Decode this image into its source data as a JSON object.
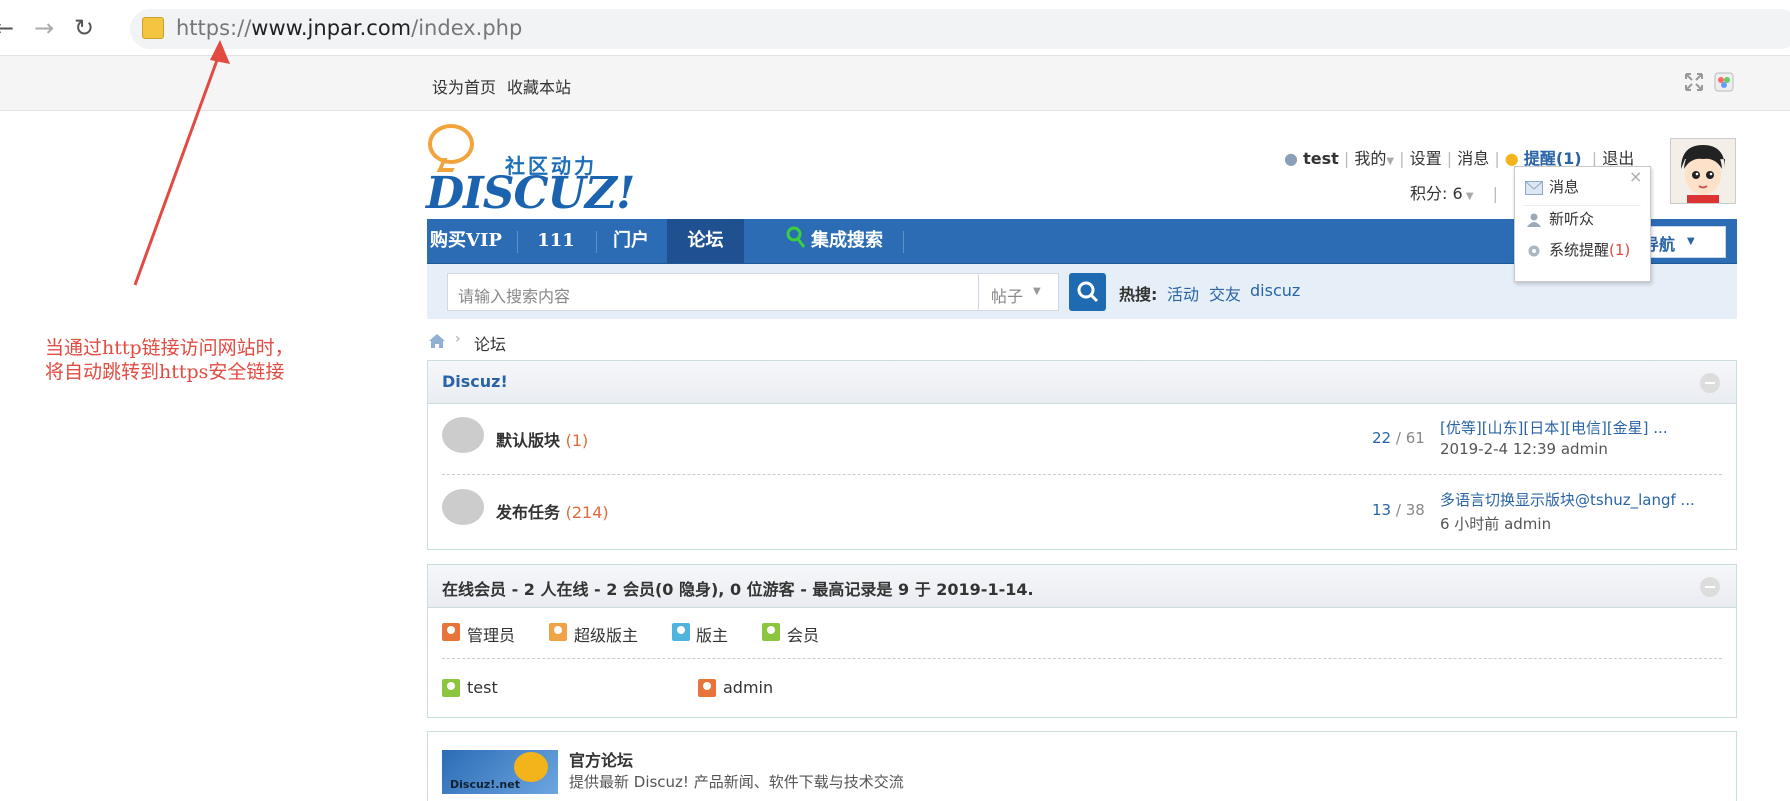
{
  "browser": {
    "url_prefix": "https://",
    "url_host": "www.jnpar.com",
    "url_path": "/index.php",
    "back": "←",
    "forward": "→",
    "reload": "↻"
  },
  "topbar": {
    "set_home": "设为首页",
    "bookmark": "收藏本站"
  },
  "logo": {
    "cn_text": "社区动力",
    "en_text": "DISCUZ!"
  },
  "user": {
    "name": "test",
    "my": "我的",
    "settings": "设置",
    "messages": "消息",
    "reminder": "提醒(1)",
    "logout": "退出",
    "credits": "积分: 6"
  },
  "reminder_popup": {
    "items": [
      {
        "label": "消息",
        "icon": "envelope-icon"
      },
      {
        "label": "新听众",
        "icon": "user-icon"
      },
      {
        "label": "系统提醒",
        "count": "(1)",
        "icon": "gear-icon"
      }
    ]
  },
  "nav": {
    "items": [
      "购买VIP",
      "111",
      "门户",
      "论坛",
      "集成搜索"
    ],
    "active_index": 3,
    "quick_nav": "导航"
  },
  "search": {
    "placeholder": "请输入搜索内容",
    "type": "帖子",
    "hot_label": "热搜:",
    "hot_links": [
      "活动",
      "交友",
      "discuz"
    ]
  },
  "breadcrumb": {
    "current": "论坛"
  },
  "forum_group": {
    "title": "Discuz!",
    "forums": [
      {
        "name": "默认版块",
        "count": "(1)",
        "threads": "22",
        "posts": "61",
        "last_title": "[优等][山东][日本][电信][金星] ...",
        "last_meta": "2019-2-4 12:39 admin"
      },
      {
        "name": "发布任务",
        "count": "(214)",
        "threads": "13",
        "posts": "38",
        "last_title": "多语言切换显示版块@tshuz_langf ...",
        "last_meta": "6 小时前 admin"
      }
    ]
  },
  "online": {
    "title": "在线会员 - 2 人在线 - 2 会员(0 隐身), 0 位游客 - 最高记录是 9 于 2019-1-14.",
    "legend": [
      {
        "label": "管理员",
        "color": "#e8743b"
      },
      {
        "label": "超级版主",
        "color": "#f0a246"
      },
      {
        "label": "版主",
        "color": "#4fb3de"
      },
      {
        "label": "会员",
        "color": "#8cc63f"
      }
    ],
    "members": [
      {
        "name": "test",
        "color": "#8cc63f"
      },
      {
        "name": "admin",
        "color": "#e8743b"
      }
    ]
  },
  "official": {
    "title": "官方论坛",
    "desc": "提供最新 Discuz! 产品新闻、软件下载与技术交流",
    "logo_text": "Discuz!.net"
  },
  "annotation": {
    "line1": "当通过http链接访问网站时，",
    "line2": "将自动跳转到https安全链接"
  },
  "colors": {
    "accent": "#2b6cb5",
    "annotation": "#e24b42",
    "link": "#2a64a6"
  }
}
